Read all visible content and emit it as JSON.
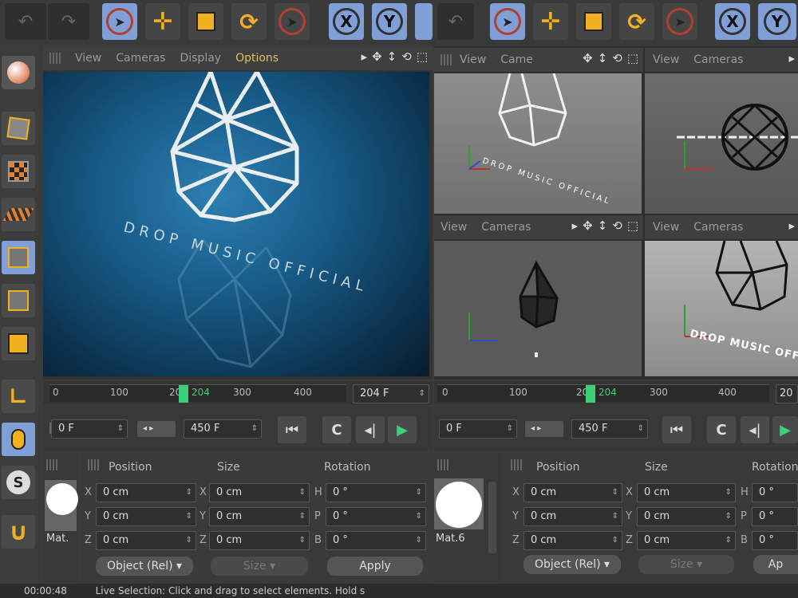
{
  "left_viewport": {
    "menu": [
      "View",
      "Cameras",
      "Display",
      "Options"
    ],
    "render_text": "DROP MUSIC OFFICIAL"
  },
  "right_viewports": {
    "top_left_menu": [
      "View",
      "Came"
    ],
    "top_right_menu": [
      "View",
      "Cameras"
    ],
    "bottom_left_menu": [
      "View",
      "Cameras"
    ],
    "bottom_right_menu": [
      "View",
      "Cameras"
    ],
    "perspective_text": "DROP MUSIC OFFICIAL",
    "top_text": "DROP MUSIC OFFICIAL",
    "bottom_right_text": "DROP MUSIC OFFI"
  },
  "timeline_left": {
    "ticks": [
      "0",
      "100",
      "200",
      "300",
      "400"
    ],
    "current_frame": "204",
    "current_field": "204 F",
    "start_field": "0 F",
    "end_field": "450 F"
  },
  "timeline_right": {
    "ticks": [
      "0",
      "100",
      "200",
      "300",
      "400"
    ],
    "current_frame": "204",
    "current_field": "20",
    "start_field": "0 F",
    "end_field": "450 F"
  },
  "attributes_left": {
    "headers": [
      "Position",
      "Size",
      "Rotation"
    ],
    "axes_pos": [
      "X",
      "Y",
      "Z"
    ],
    "axes_rot": [
      "H",
      "P",
      "B"
    ],
    "pos_values": [
      "0 cm",
      "0 cm",
      "0 cm"
    ],
    "size_values": [
      "0 cm",
      "0 cm",
      "0 cm"
    ],
    "rot_values": [
      "0 °",
      "0 °",
      "0 °"
    ],
    "material": "Mat.",
    "coord_mode": "Object (Rel)",
    "size_mode": "Size",
    "apply": "Apply"
  },
  "attributes_right": {
    "headers": [
      "Position",
      "Size",
      "Rotation"
    ],
    "axes_pos": [
      "X",
      "Y",
      "Z"
    ],
    "axes_rot": [
      "H",
      "P",
      "B"
    ],
    "pos_values": [
      "0 cm",
      "0 cm",
      "0 cm"
    ],
    "size_values": [
      "0 cm",
      "0 cm",
      "0 cm"
    ],
    "rot_values": [
      "0 °",
      "0 °",
      "0 °"
    ],
    "material": "Mat.6",
    "coord_mode": "Object (Rel)",
    "size_mode": "Size",
    "apply": "Ap"
  },
  "status": {
    "time": "00:00:48",
    "message": "Live Selection: Click and drag to select elements. Hold s"
  },
  "toolbar": {
    "axis_x": "X",
    "axis_y": "Y"
  }
}
